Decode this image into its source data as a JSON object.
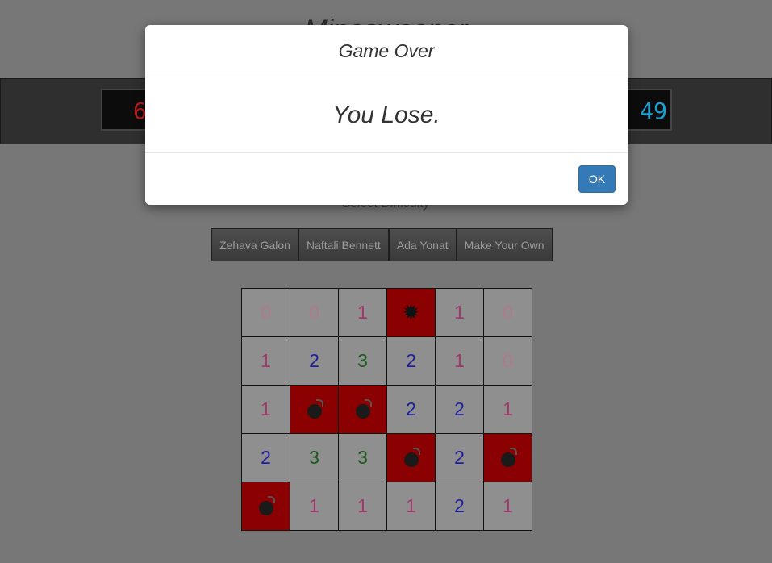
{
  "header": {
    "title": "Minesweeper"
  },
  "counters": {
    "mines_remaining": "6",
    "timer": "49"
  },
  "difficulty": {
    "label": "Select Difficulty",
    "options": [
      "Zehava Galon",
      "Naftali Bennett",
      "Ada Yonat",
      "Make Your Own"
    ]
  },
  "board": {
    "rows": 5,
    "cols": 6,
    "cells": [
      [
        "0",
        "0",
        "1",
        "exploded",
        "1",
        "0"
      ],
      [
        "1",
        "2",
        "3",
        "2",
        "1",
        "0"
      ],
      [
        "1",
        "mine",
        "mine",
        "2",
        "2",
        "1"
      ],
      [
        "2",
        "3",
        "3",
        "mine",
        "2",
        "mine"
      ],
      [
        "mine",
        "1",
        "1",
        "1",
        "2",
        "1"
      ]
    ],
    "colors": {
      "mine_bg": "#8b0000",
      "cell_bg": "#8f8f8f"
    }
  },
  "modal": {
    "title": "Game Over",
    "message": "You Lose.",
    "ok_label": "OK"
  }
}
